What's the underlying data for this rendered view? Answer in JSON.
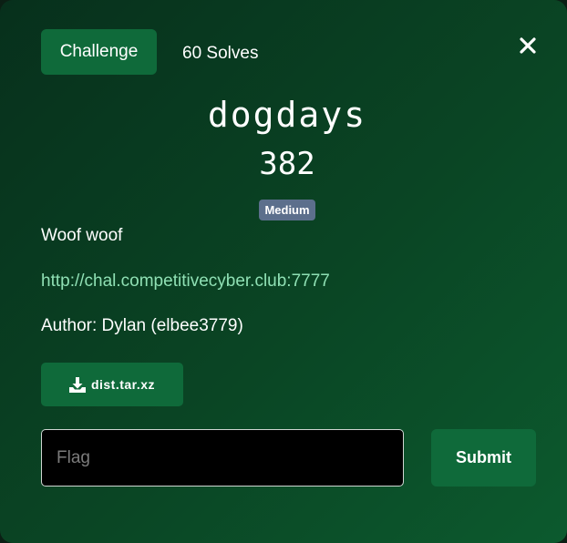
{
  "tabs": {
    "challenge_label": "Challenge",
    "solves_label": "60 Solves"
  },
  "close_icon": "close-icon",
  "challenge": {
    "name": "dogdays",
    "points": "382",
    "difficulty": "Medium",
    "description": "Woof woof",
    "link": "http://chal.competitivecyber.club:7777",
    "author": "Author: Dylan (elbee3779)"
  },
  "files": [
    {
      "icon": "download-icon",
      "name": "dist.tar.xz"
    }
  ],
  "form": {
    "flag_placeholder": "Flag",
    "flag_value": "",
    "submit_label": "Submit"
  },
  "colors": {
    "accent": "#0f6a3a",
    "badge": "#5c6f8c",
    "link": "#8fe0b4"
  }
}
